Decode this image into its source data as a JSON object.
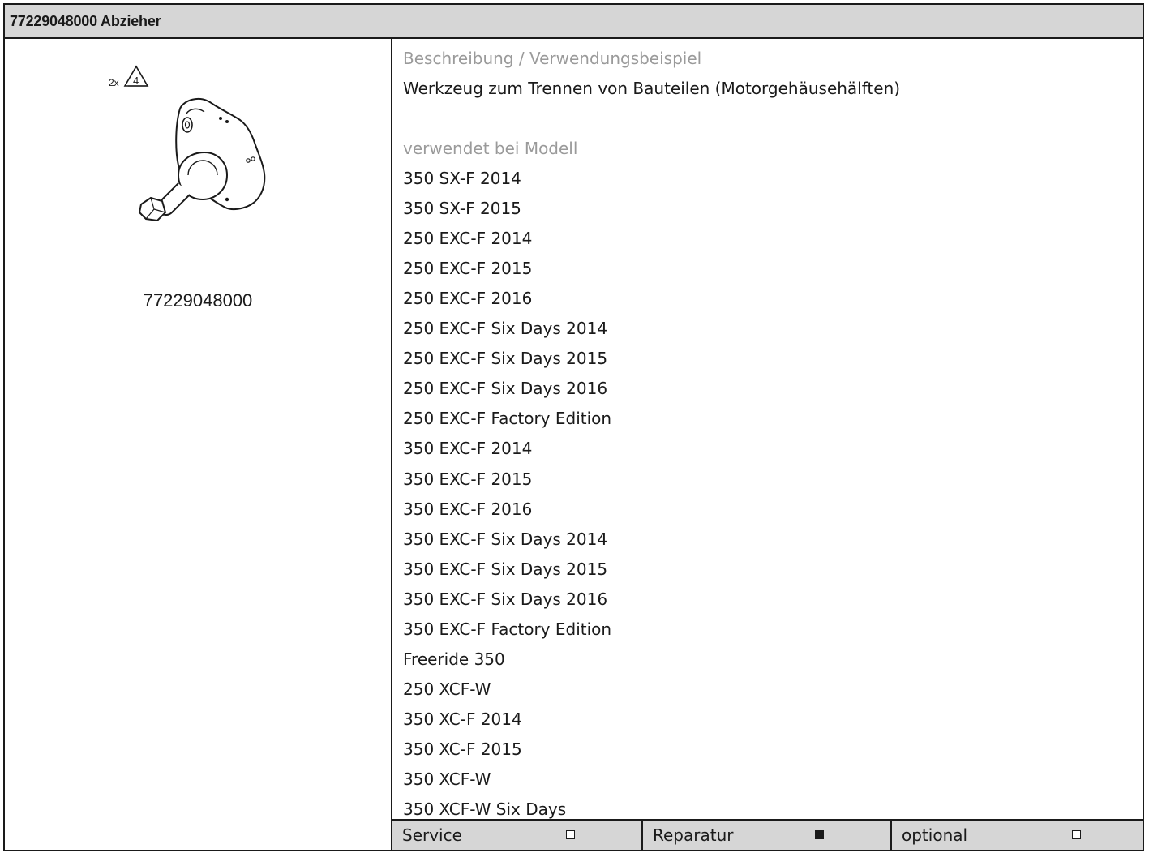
{
  "header": {
    "title": "77229048000 Abzieher"
  },
  "figure": {
    "quantity_label": "2x",
    "callout_number": "4",
    "part_number": "77229048000"
  },
  "description": {
    "heading": "Beschreibung / Verwendungsbeispiel",
    "text": "Werkzeug zum Trennen von Bauteilen (Motorgehäusehälften)"
  },
  "models": {
    "heading": "verwendet bei Modell",
    "items": [
      "350 SX-F 2014",
      "350 SX-F 2015",
      "250 EXC-F 2014",
      "250 EXC-F 2015",
      "250 EXC-F 2016",
      "250 EXC-F Six Days 2014",
      "250 EXC-F Six Days 2015",
      "250 EXC-F Six Days 2016",
      "250 EXC-F Factory Edition",
      "350 EXC-F 2014",
      "350 EXC-F 2015",
      "350 EXC-F 2016",
      "350 EXC-F Six Days 2014",
      "350 EXC-F Six Days 2015",
      "350 EXC-F Six Days 2016",
      "350 EXC-F Factory Edition",
      "Freeride 350",
      "250 XCF-W",
      "350 XC-F 2014",
      "350 XC-F 2015",
      "350 XCF-W",
      "350 XCF-W Six Days"
    ]
  },
  "footer": {
    "service": {
      "label": "Service",
      "checked": false
    },
    "reparatur": {
      "label": "Reparatur",
      "checked": true
    },
    "optional": {
      "label": "optional",
      "checked": false
    }
  }
}
